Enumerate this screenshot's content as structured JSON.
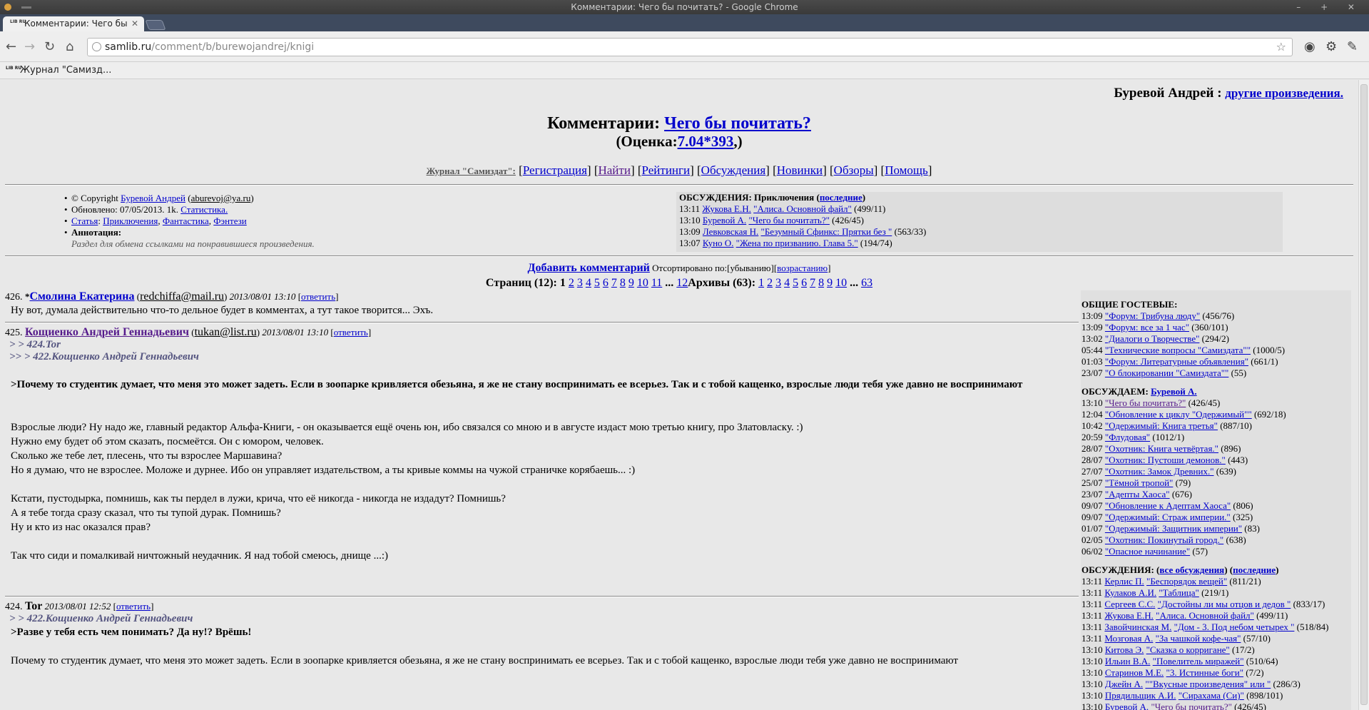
{
  "window": {
    "title": "Комментарии: Чего бы почитать? - Google Chrome",
    "controls": "– + ✕"
  },
  "tab": {
    "title": "Комментарии: Чего бы",
    "favicon_text": "LIB RU"
  },
  "toolbar": {
    "url_host": "samlib.ru",
    "url_path": "/comment/b/burewojandrej/knigi"
  },
  "bookmarks": [
    {
      "label": "Журнал \"Самизд..."
    }
  ],
  "page": {
    "author_top": "Буревой Андрей :",
    "author_top_link": "другие произведения.",
    "title_prefix": "Комментарии:",
    "title_link": "Чего бы почитать?",
    "rating_prefix": "(Оценка:",
    "rating_link": "7.04*393",
    "rating_suffix": ",)",
    "menu_label": "Журнал \"Самиздат\":",
    "menu": [
      "Регистрация",
      "Найти",
      "Рейтинги",
      "Обсуждения",
      "Новинки",
      "Обзоры",
      "Помощь"
    ],
    "info": {
      "copyright_prefix": "© Copyright",
      "copyright_author": "Буревой Андрей",
      "copyright_email": "aburevoj@ya.ru",
      "updated": "Обновлено: 07/05/2013. 1k.",
      "stats_link": "Статистика.",
      "type_link": "Статья",
      "genres": [
        "Приключения",
        "Фантастика",
        "Фэнтези"
      ],
      "annotation_label": "Аннотация:",
      "annotation": "Раздел для обмена ссылками на понравившиеся произведения."
    },
    "discussions_box": {
      "title": "ОБСУЖДЕНИЯ: Приключения",
      "last_link": "последние",
      "rows": [
        {
          "time": "13:11",
          "author": "Жукова Е.Н.",
          "work": "\"Алиса. Основной файл\"",
          "count": "(499/11)"
        },
        {
          "time": "13:10",
          "author": "Буревой А.",
          "work": "\"Чего бы почитать?\"",
          "count": "(426/45)"
        },
        {
          "time": "13:09",
          "author": "Левковская Н.",
          "work": "\"Безумный Сфинкс: Прятки без \"",
          "count": "(563/33)"
        },
        {
          "time": "13:07",
          "author": "Куно О.",
          "work": "\"Жена по призванию. Глава 5.\"",
          "count": "(194/74)"
        }
      ]
    },
    "controls": {
      "add_comment": "Добавить комментарий",
      "sorted": "Отсортировано по:[убыванию][",
      "asc": "возрастанию",
      "close": "]"
    },
    "pager": {
      "pages_label": "Страниц (12):",
      "current": "1",
      "pages": [
        "2",
        "3",
        "4",
        "5",
        "6",
        "7",
        "8",
        "9",
        "10",
        "11"
      ],
      "ellipsis": "...",
      "last": "12",
      "archives_label": "Архивы (63):",
      "archives": [
        "1",
        "2",
        "3",
        "4",
        "5",
        "6",
        "7",
        "8",
        "9",
        "10"
      ],
      "archives_last": "63"
    },
    "reply_label": "ответить",
    "comments": [
      {
        "num": "426.",
        "star": "*",
        "author": "Смолина Екатерина",
        "email": "redchiffa@mail.ru",
        "date": "2013/08/01 13:10",
        "quotes": [],
        "lines": [
          "Ну вот, думала действительно что-то дельное будет в комментах, а тут такое творится... Эхъ."
        ]
      },
      {
        "num": "425.",
        "author": "Кощиенко Андрей Геннадьевич",
        "email": "tukan@list.ru",
        "date": "2013/08/01 13:10",
        "quotes": [
          "> > 424.Tor",
          ">> > 422.Кощиенко Андрей Геннадьевич"
        ],
        "bold_lines": [
          ">Почему то студентик думает, что меня это может задеть. Если в зоопарке кривляется обезьяна, я же не стану воспринимать ее всерьез. Так и с тобой кащенко, взрослые люди тебя уже давно не воспринимают"
        ],
        "lines": [
          "Взрослые люди? Ну надо же, главный редактор Альфа-Книги, - он оказывается ещё очень юн, ибо связался со мною и в августе издаст мою третью книгу, про Златовласку. :)",
          "Нужно ему будет об этом сказать, посмеётся. Он с юмором, человек.",
          "Сколько же тебе лет, плесень, что ты взрослее Маршавина?",
          "Но я думаю, что не взрослее. Моложе и дурнее. Ибо он управляет издательством, а ты кривые коммы на чужой страничке корябаешь... :)",
          "",
          "Кстати, пустодырка, помнишь, как ты пердел в лужи, крича, что её никогда - никогда не издадут? Помнишь?",
          "А я тебе тогда сразу сказал, что ты тупой дурак. Помнишь?",
          "Ну и кто из нас оказался прав?",
          "",
          "Так что сиди и помалкивай ничтожный неудачник. Я над тобой смеюсь, днище ...:)"
        ]
      },
      {
        "num": "424.",
        "author": "Tor",
        "date": "2013/08/01 12:52",
        "quotes": [
          "> > 422.Кощиенко Андрей Геннадьевич"
        ],
        "bold_lines": [
          ">Разве у тебя есть чем понимать? Да ну!? Врёшь!"
        ],
        "lines": [
          "Почему то студентик думает, что меня это может задеть. Если в зоопарке кривляется обезьяна, я же не стану воспринимать ее всерьез. Так и с тобой кащенко, взрослые люди тебя уже давно не воспринимают"
        ]
      }
    ],
    "sidebar": {
      "guest_title": "ОБЩИЕ ГОСТЕВЫЕ:",
      "guest": [
        {
          "time": "13:09",
          "work": "\"Форум: Трибуна люду\"",
          "count": "(456/76)"
        },
        {
          "time": "13:09",
          "work": "\"Форум: все за 1 час\"",
          "count": "(360/101)"
        },
        {
          "time": "13:02",
          "work": "\"Диалоги о Творчестве\"",
          "count": "(294/2)"
        },
        {
          "time": "05:44",
          "work": "\"Технические вопросы \"Самиздата\"\"",
          "count": "(1000/5)"
        },
        {
          "time": "01:03",
          "work": "\"Форум: Литературные объявления\"",
          "count": "(661/1)"
        },
        {
          "time": "23/07",
          "work": "\"О блокировании \"Самиздата\"\"",
          "count": "(55)"
        }
      ],
      "author_title": "ОБСУЖДАЕМ:",
      "author_link": "Буревой А.",
      "author_works": [
        {
          "time": "13:10",
          "work": "\"Чего бы почитать?\"",
          "count": "(426/45)"
        },
        {
          "time": "12:04",
          "work": "\"Обновление к циклу \"Одержимый\"\"",
          "count": "(692/18)"
        },
        {
          "time": "10:42",
          "work": "\"Одержимый: Книга третья\"",
          "count": "(887/10)"
        },
        {
          "time": "20:59",
          "work": "\"Флудовая\"",
          "count": "(1012/1)"
        },
        {
          "time": "28/07",
          "work": "\"Охотник: Книга четвёртая.\"",
          "count": "(896)"
        },
        {
          "time": "28/07",
          "work": "\"Охотник: Пустоши демонов.\"",
          "count": "(443)"
        },
        {
          "time": "27/07",
          "work": "\"Охотник: Замок Древних.\"",
          "count": "(639)"
        },
        {
          "time": "25/07",
          "work": "\"Тёмной тропой\"",
          "count": "(79)"
        },
        {
          "time": "23/07",
          "work": "\"Адепты Хаоса\"",
          "count": "(676)"
        },
        {
          "time": "09/07",
          "work": "\"Обновление к Адептам Хаоса\"",
          "count": "(806)"
        },
        {
          "time": "09/07",
          "work": "\"Одержимый: Страж империи.\"",
          "count": "(325)"
        },
        {
          "time": "01/07",
          "work": "\"Одержимый: Защитник империи\"",
          "count": "(83)"
        },
        {
          "time": "02/05",
          "work": "\"Охотник: Покинутый город.\"",
          "count": "(638)"
        },
        {
          "time": "06/02",
          "work": "\"Опасное начинание\"",
          "count": "(57)"
        }
      ],
      "disc_title": "ОБСУЖДЕНИЯ:",
      "disc_all": "все обсуждения",
      "disc_last": "последние",
      "disc": [
        {
          "time": "13:11",
          "author": "Керлис П.",
          "work": "\"Беспорядок вещей\"",
          "count": "(811/21)"
        },
        {
          "time": "13:11",
          "author": "Кулаков А.И.",
          "work": "\"Таблица\"",
          "count": "(219/1)"
        },
        {
          "time": "13:11",
          "author": "Сергеев С.С.",
          "work": "\"Достойны ли мы отцов и дедов \"",
          "count": "(833/17)"
        },
        {
          "time": "13:11",
          "author": "Жукова Е.Н.",
          "work": "\"Алиса. Основной файл\"",
          "count": "(499/11)"
        },
        {
          "time": "13:11",
          "author": "Завойчинская М.",
          "work": "\"Дом - 3. Под небом четырех \"",
          "count": "(518/84)"
        },
        {
          "time": "13:11",
          "author": "Мозговая А.",
          "work": "\"За чашкой кофе-чая\"",
          "count": "(57/10)"
        },
        {
          "time": "13:10",
          "author": "Китова Э.",
          "work": "\"Сказка о корригане\"",
          "count": "(17/2)"
        },
        {
          "time": "13:10",
          "author": "Ильин В.А.",
          "work": "\"Повелитель миражей\"",
          "count": "(510/64)"
        },
        {
          "time": "13:10",
          "author": "Старинов М.Е.",
          "work": "\"3. Истинные боги\"",
          "count": "(7/2)"
        },
        {
          "time": "13:10",
          "author": "Джейн А.",
          "work": "\"\"Вкусные произведения\" или \"",
          "count": "(286/3)"
        },
        {
          "time": "13:10",
          "author": "Прядильщик А.И.",
          "work": "\"Сирахама (Си)\"",
          "count": "(898/101)"
        },
        {
          "time": "13:10",
          "author": "Буревой А.",
          "work": "\"Чего бы почитать?\"",
          "count": "(426/45)"
        }
      ]
    }
  }
}
